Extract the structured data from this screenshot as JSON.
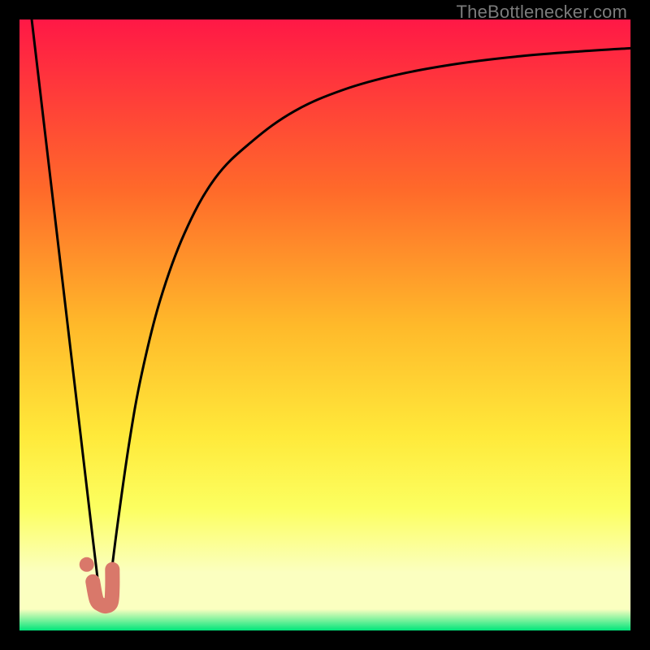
{
  "watermark": "TheBottlenecker.com",
  "colors": {
    "bg_black": "#000000",
    "grad_top": "#ff1846",
    "grad_mid1": "#ff6a2a",
    "grad_mid2": "#ffb92a",
    "grad_mid3": "#ffe93a",
    "grad_yellow": "#fcff60",
    "grad_pale": "#fbffc0",
    "grad_green": "#00e57a",
    "curve": "#000000",
    "marker_fill": "#d9786a",
    "marker_stroke": "#d9786a"
  },
  "chart_data": {
    "type": "line",
    "title": "",
    "xlabel": "",
    "ylabel": "",
    "xlim": [
      0,
      100
    ],
    "ylim": [
      0,
      100
    ],
    "series": [
      {
        "name": "left-curve",
        "x": [
          2,
          4,
          6,
          8,
          10,
          12,
          13.2
        ],
        "values": [
          100,
          83,
          66,
          49,
          32,
          15,
          5
        ]
      },
      {
        "name": "right-curve",
        "x": [
          14.5,
          16,
          18,
          20,
          23,
          27,
          32,
          38,
          45,
          53,
          62,
          72,
          82,
          92,
          100
        ],
        "values": [
          5,
          17,
          31,
          42,
          54,
          65,
          74,
          80,
          85,
          88.5,
          91,
          92.8,
          94,
          94.8,
          95.3
        ]
      }
    ],
    "marker": {
      "name": "j-marker",
      "path_x": [
        12.0,
        12.6,
        13.4,
        14.2,
        15.0,
        15.2,
        15.2
      ],
      "path_y": [
        8.0,
        5.0,
        4.2,
        4.0,
        4.6,
        7.0,
        10.0
      ],
      "dot": {
        "x": 11.0,
        "y": 10.8
      }
    }
  }
}
